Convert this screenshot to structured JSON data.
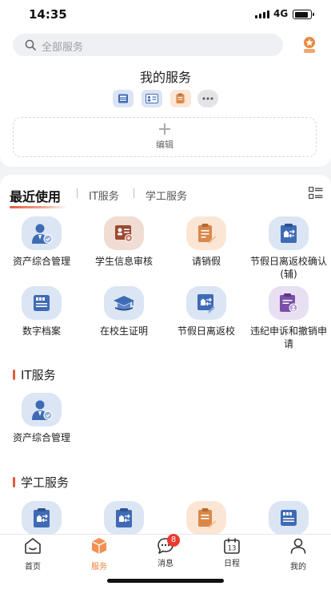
{
  "status_bar": {
    "time": "14:35",
    "network": "4G",
    "battery_level": 0.8
  },
  "search": {
    "placeholder": "全部服务"
  },
  "my_services": {
    "title": "我的服务",
    "icons": [
      "archive-icon",
      "certificate-icon",
      "leave-request-icon",
      "more-icon"
    ],
    "edit_label": "编辑"
  },
  "tabs": [
    {
      "label": "最近使用",
      "active": true
    },
    {
      "label": "IT服务",
      "active": false
    },
    {
      "label": "学工服务",
      "active": false
    }
  ],
  "recent": [
    {
      "label": "资产综合管理",
      "icon": "asset-management-icon"
    },
    {
      "label": "学生信息审核",
      "icon": "student-info-review-icon"
    },
    {
      "label": "请销假",
      "icon": "leave-request-icon"
    },
    {
      "label": "节假日离返校确认(辅)",
      "icon": "holiday-leave-confirm-icon"
    },
    {
      "label": "数字档案",
      "icon": "digital-archive-icon"
    },
    {
      "label": "在校生证明",
      "icon": "student-certificate-icon"
    },
    {
      "label": "节假日离返校",
      "icon": "holiday-leave-icon"
    },
    {
      "label": "违纪申诉和撤销申请",
      "icon": "discipline-appeal-icon"
    }
  ],
  "it_section": {
    "title": "IT服务",
    "items": [
      {
        "label": "资产综合管理",
        "icon": "asset-management-icon"
      }
    ]
  },
  "xuegong_section": {
    "title": "学工服务",
    "items": [
      {
        "icon": "holiday-leave-confirm-icon"
      },
      {
        "icon": "holiday-leave-icon"
      },
      {
        "icon": "leave-request-icon"
      },
      {
        "icon": "digital-archive-icon"
      }
    ]
  },
  "tabbar": [
    {
      "label": "首页",
      "icon": "home-icon",
      "active": false
    },
    {
      "label": "服务",
      "icon": "services-cube-icon",
      "active": true
    },
    {
      "label": "消息",
      "icon": "message-icon",
      "active": false,
      "badge": "8"
    },
    {
      "label": "日程",
      "icon": "calendar-icon",
      "active": false,
      "calendar_day": "13"
    },
    {
      "label": "我的",
      "icon": "profile-icon",
      "active": false
    }
  ],
  "colors": {
    "accent": "#e35a3c",
    "tab_active": "#f08040",
    "blue_tile": "#dbe5f4",
    "blue_icon": "#3f6bb5",
    "brown_tile": "#f1dcd3",
    "brown_icon": "#9a4a34",
    "orange_tile": "#fbe6d6",
    "orange_icon": "#d9884a",
    "purple_tile": "#e8dff2",
    "purple_icon": "#7a4fa6",
    "badge": "#ea3a2f"
  }
}
